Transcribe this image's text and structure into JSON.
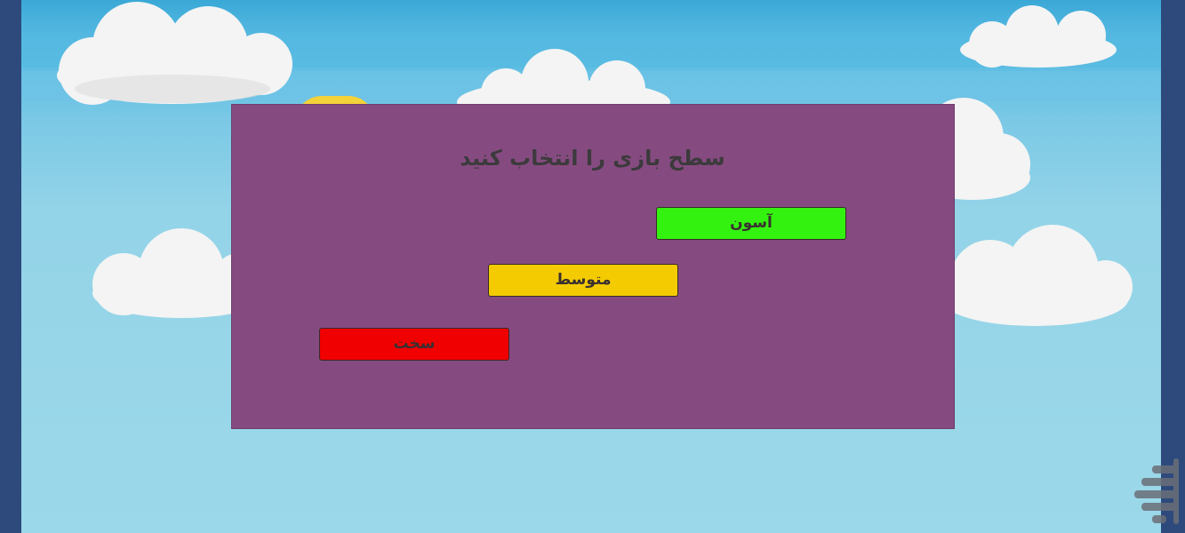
{
  "title": "سطح بازی را انتخاب کنید",
  "levels": {
    "easy": "آسون",
    "medium": "متوسط",
    "hard": "سخت"
  },
  "colors": {
    "dialog": "#854b80",
    "easy": "#33f20f",
    "medium": "#f3cb00",
    "hard": "#f00000",
    "frame": "#2e4a7c",
    "sky": "#9bd8e9"
  },
  "icons": {
    "watermark": "store-logo-icon"
  }
}
